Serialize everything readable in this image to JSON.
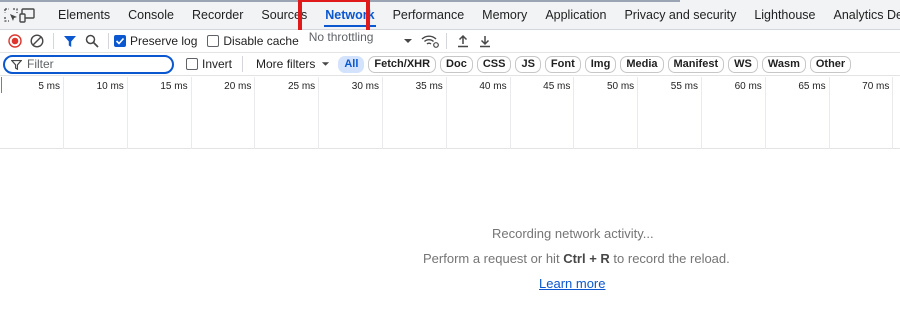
{
  "tabs": [
    {
      "label": "Elements"
    },
    {
      "label": "Console"
    },
    {
      "label": "Recorder"
    },
    {
      "label": "Sources"
    },
    {
      "label": "Network",
      "active": true
    },
    {
      "label": "Performance"
    },
    {
      "label": "Memory"
    },
    {
      "label": "Application"
    },
    {
      "label": "Privacy and security"
    },
    {
      "label": "Lighthouse"
    },
    {
      "label": "Analytics Debugger"
    }
  ],
  "toolbar": {
    "preserve_log": {
      "label": "Preserve log",
      "checked": true
    },
    "disable_cache": {
      "label": "Disable cache",
      "checked": false
    },
    "throttling": "No throttling"
  },
  "filter": {
    "placeholder": "Filter",
    "invert_label": "Invert",
    "more_filters_label": "More filters",
    "types": [
      "All",
      "Fetch/XHR",
      "Doc",
      "CSS",
      "JS",
      "Font",
      "Img",
      "Media",
      "Manifest",
      "WS",
      "Wasm",
      "Other"
    ],
    "active_type": "All"
  },
  "timeline": {
    "ticks": [
      "5 ms",
      "10 ms",
      "15 ms",
      "20 ms",
      "25 ms",
      "30 ms",
      "35 ms",
      "40 ms",
      "45 ms",
      "50 ms",
      "55 ms",
      "60 ms",
      "65 ms",
      "70 ms"
    ]
  },
  "empty_state": {
    "line1": "Recording network activity...",
    "line2_before": "Perform a request or hit",
    "shortcut": "Ctrl + R",
    "line2_after": "to record the reload.",
    "link": "Learn more"
  },
  "colors": {
    "accent": "#0b57d0",
    "record": "#dc362e",
    "highlight": "#e0191b"
  }
}
